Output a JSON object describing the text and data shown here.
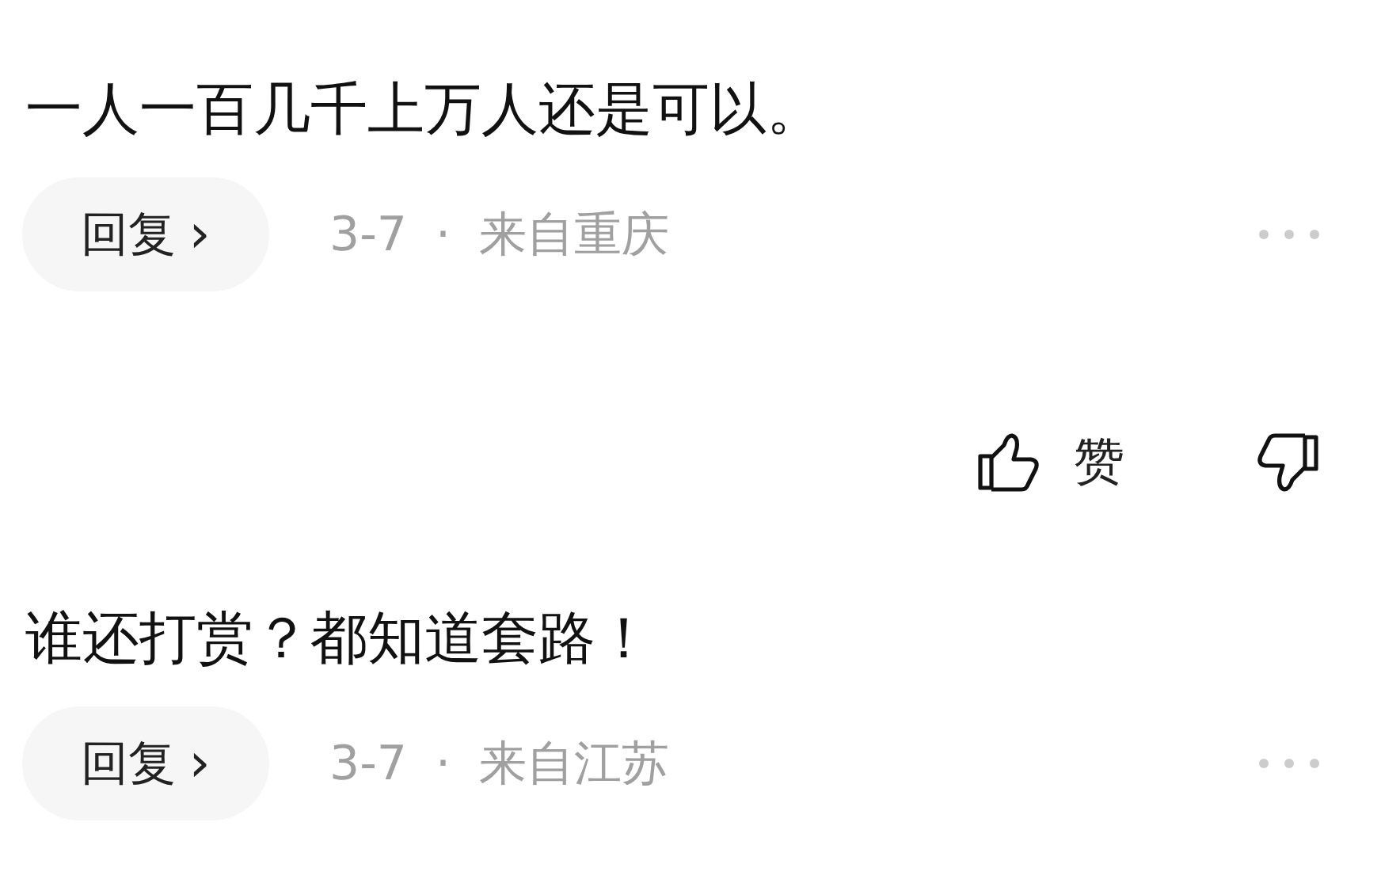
{
  "items": [
    {
      "kind": "comment",
      "text": "一人一百几千上万人还是可以。",
      "reply": "回复",
      "chevron": "›",
      "date": "3-7",
      "separator": "·",
      "location": "来自重庆"
    },
    {
      "kind": "actions",
      "like": "赞"
    },
    {
      "kind": "comment",
      "text": "谁还打赏？都知道套路！",
      "reply": "回复",
      "chevron": "›",
      "date": "3-7",
      "separator": "·",
      "location": "来自江苏"
    }
  ]
}
